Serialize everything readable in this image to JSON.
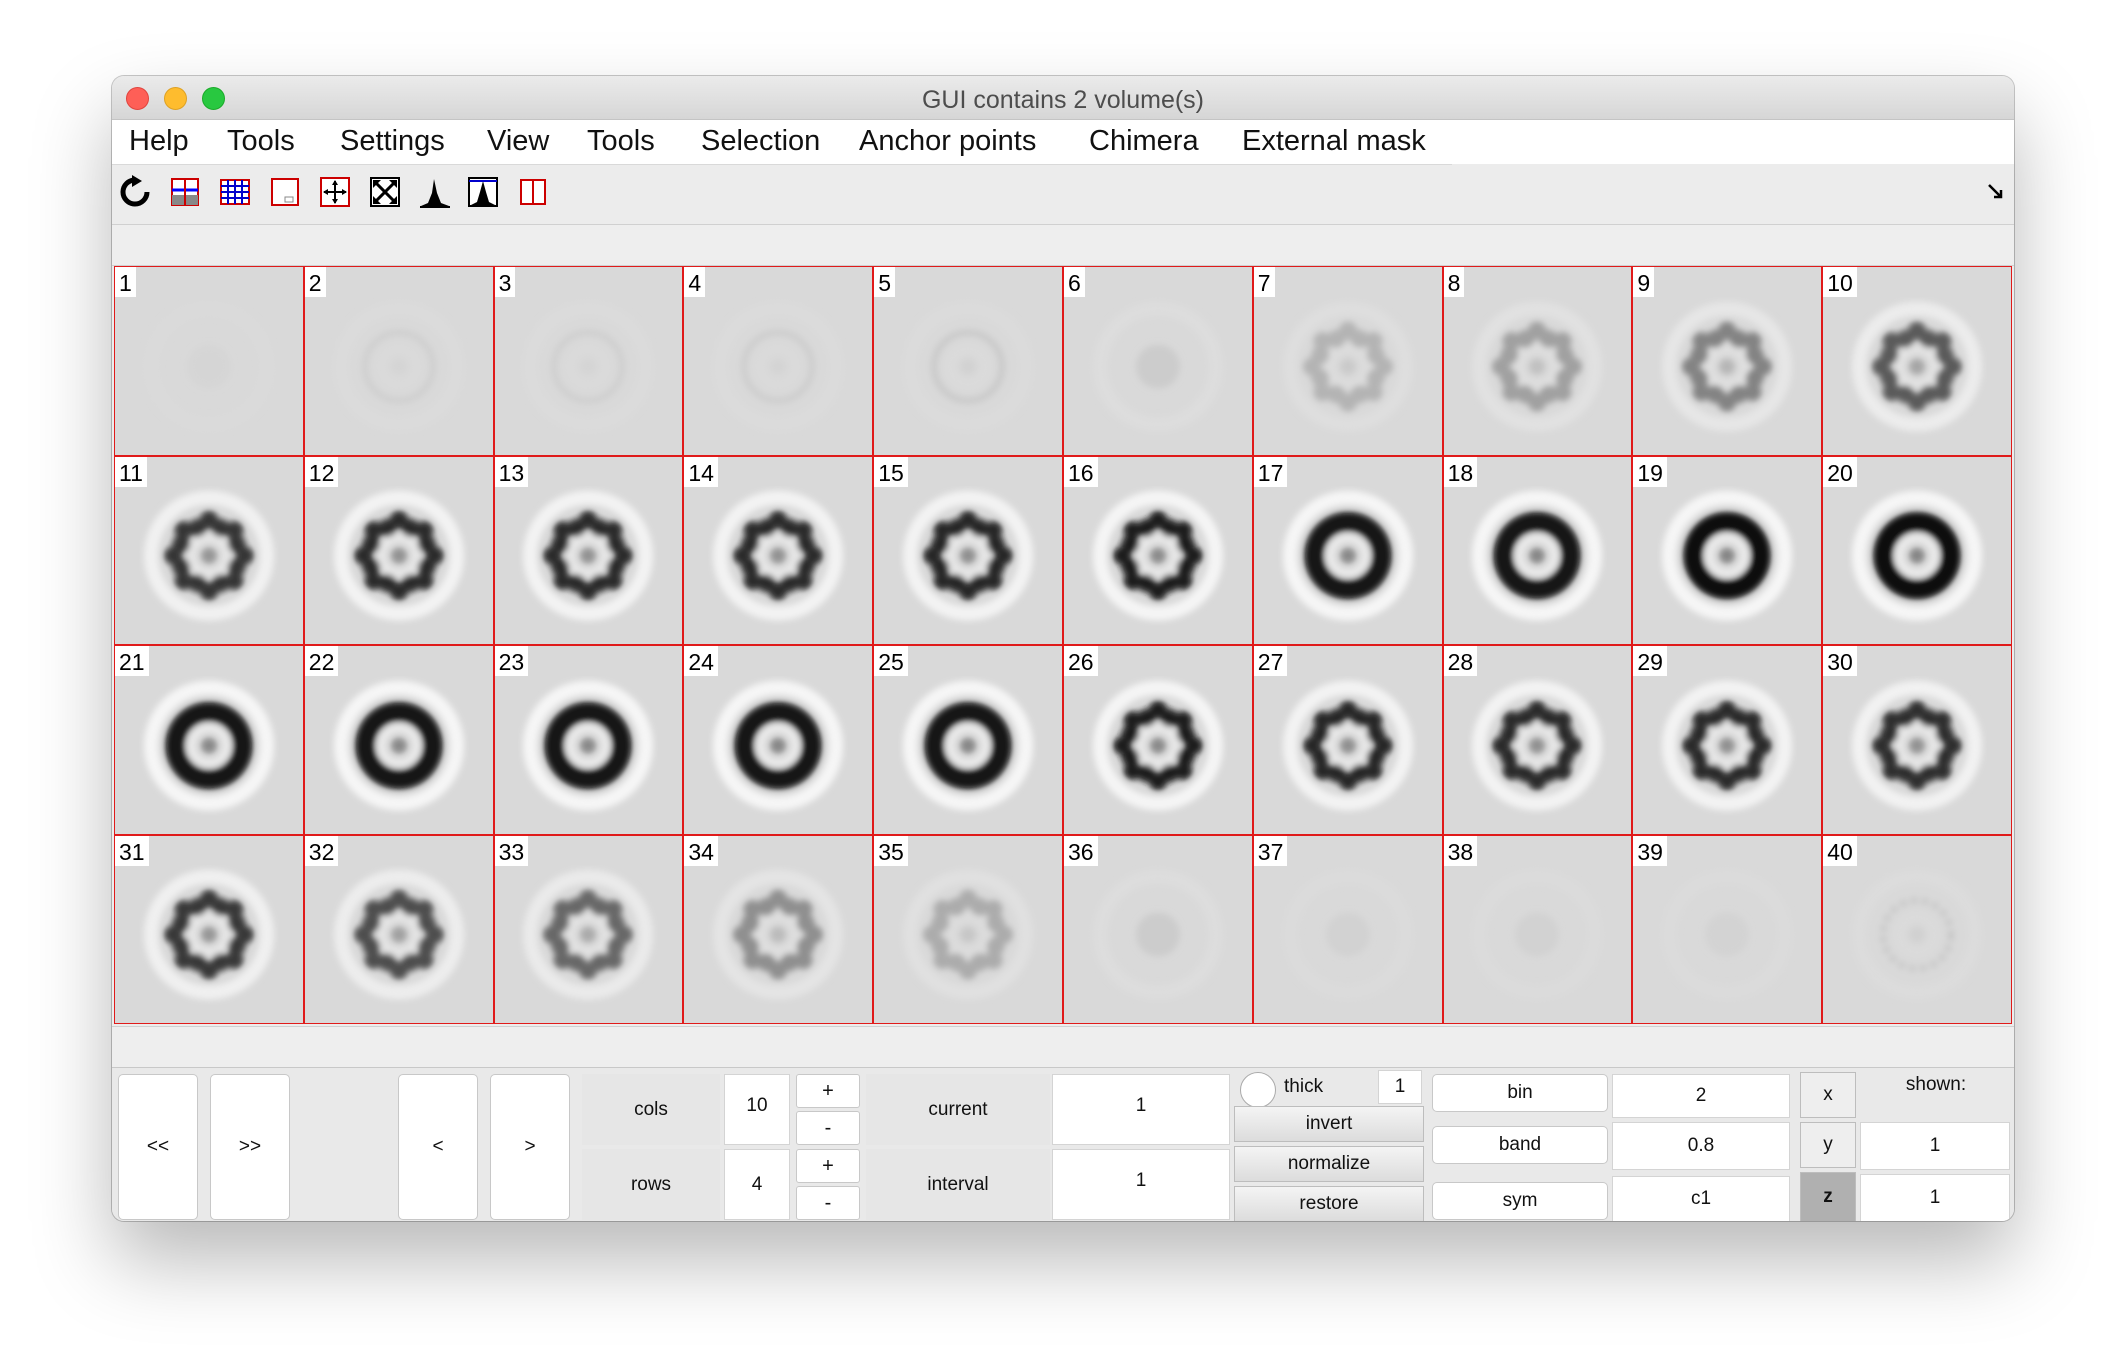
{
  "window": {
    "title": "GUI contains 2 volume(s)"
  },
  "menu": [
    "Help",
    "Tools",
    "Settings",
    "View",
    "Tools",
    "Selection",
    "Anchor points",
    "Chimera",
    "External mask"
  ],
  "toolbar": {
    "icons": [
      "refresh-icon",
      "slice-stack-icon",
      "grid-view-icon",
      "small-box-icon",
      "fit-arrows-icon",
      "expand-icon",
      "histogram-icon",
      "histogram-box-icon",
      "split-panel-icon"
    ]
  },
  "grid": {
    "cells": [
      {
        "n": "1",
        "i": 0.03,
        "t": "blob"
      },
      {
        "n": "2",
        "i": 0.05,
        "t": "ring"
      },
      {
        "n": "3",
        "i": 0.05,
        "t": "ring"
      },
      {
        "n": "4",
        "i": 0.06,
        "t": "ring"
      },
      {
        "n": "5",
        "i": 0.08,
        "t": "ring"
      },
      {
        "n": "6",
        "i": 0.12,
        "t": "blob"
      },
      {
        "n": "7",
        "i": 0.18,
        "t": "dots"
      },
      {
        "n": "8",
        "i": 0.28,
        "t": "dots"
      },
      {
        "n": "9",
        "i": 0.42,
        "t": "dots"
      },
      {
        "n": "10",
        "i": 0.62,
        "t": "dots"
      },
      {
        "n": "11",
        "i": 0.8,
        "t": "dots"
      },
      {
        "n": "12",
        "i": 0.85,
        "t": "dots"
      },
      {
        "n": "13",
        "i": 0.85,
        "t": "dots"
      },
      {
        "n": "14",
        "i": 0.85,
        "t": "dots"
      },
      {
        "n": "15",
        "i": 0.87,
        "t": "dots"
      },
      {
        "n": "16",
        "i": 0.92,
        "t": "dots"
      },
      {
        "n": "17",
        "i": 0.95,
        "t": "solid"
      },
      {
        "n": "18",
        "i": 0.97,
        "t": "solid"
      },
      {
        "n": "19",
        "i": 0.98,
        "t": "solid"
      },
      {
        "n": "20",
        "i": 0.98,
        "t": "solid"
      },
      {
        "n": "21",
        "i": 0.95,
        "t": "solid"
      },
      {
        "n": "22",
        "i": 0.96,
        "t": "solid"
      },
      {
        "n": "23",
        "i": 0.96,
        "t": "solid"
      },
      {
        "n": "24",
        "i": 0.97,
        "t": "solid"
      },
      {
        "n": "25",
        "i": 0.97,
        "t": "solid"
      },
      {
        "n": "26",
        "i": 0.93,
        "t": "dots"
      },
      {
        "n": "27",
        "i": 0.88,
        "t": "dots"
      },
      {
        "n": "28",
        "i": 0.86,
        "t": "dots"
      },
      {
        "n": "29",
        "i": 0.86,
        "t": "dots"
      },
      {
        "n": "30",
        "i": 0.84,
        "t": "dots"
      },
      {
        "n": "31",
        "i": 0.78,
        "t": "dots"
      },
      {
        "n": "32",
        "i": 0.68,
        "t": "dots"
      },
      {
        "n": "33",
        "i": 0.55,
        "t": "dots"
      },
      {
        "n": "34",
        "i": 0.36,
        "t": "dots"
      },
      {
        "n": "35",
        "i": 0.22,
        "t": "dots"
      },
      {
        "n": "36",
        "i": 0.12,
        "t": "blob"
      },
      {
        "n": "37",
        "i": 0.07,
        "t": "blob"
      },
      {
        "n": "38",
        "i": 0.06,
        "t": "blob"
      },
      {
        "n": "39",
        "i": 0.05,
        "t": "blob"
      },
      {
        "n": "40",
        "i": 0.1,
        "t": "dashring"
      }
    ]
  },
  "controls": {
    "nav": {
      "first": "<<",
      "last": ">>",
      "prev": "<",
      "next": ">"
    },
    "cols": {
      "label": "cols",
      "value": "10",
      "plus": "+",
      "minus": "-"
    },
    "rows": {
      "label": "rows",
      "value": "4",
      "plus": "+",
      "minus": "-"
    },
    "current": {
      "label": "current",
      "value": "1"
    },
    "interval": {
      "label": "interval",
      "value": "1"
    },
    "thick": {
      "label": "thick",
      "value": "1"
    },
    "invert": "invert",
    "normalize": "normalize",
    "restore": "restore",
    "bin": {
      "label": "bin",
      "value": "2"
    },
    "band": {
      "label": "band",
      "value": "0.8"
    },
    "sym": {
      "label": "sym",
      "value": "c1"
    },
    "axes": {
      "x": "x",
      "y": "y",
      "z": "z",
      "selected": "z"
    },
    "shown": {
      "label": "shown:",
      "y": "1",
      "z": "1"
    }
  },
  "colors": {
    "grid_border": "#e01a1a",
    "cell_bg": "#d9d9d9"
  }
}
